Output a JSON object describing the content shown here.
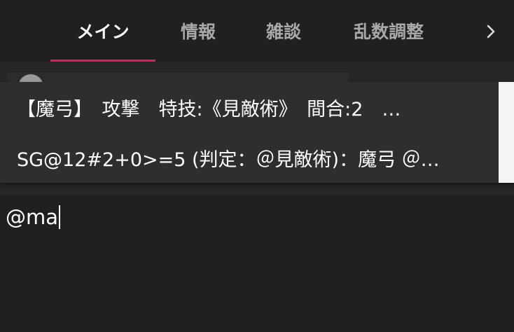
{
  "tabs": [
    {
      "label": "メイン",
      "active": true
    },
    {
      "label": "情報",
      "active": false
    },
    {
      "label": "雑談",
      "active": false
    },
    {
      "label": "乱数調整",
      "active": false
    }
  ],
  "scroll_icon": "chevron-right-icon",
  "autocomplete": {
    "items": [
      {
        "text": "【魔弓】　攻撃　特技:《見敵術》　間合:2　…"
      },
      {
        "text": "SG@12#2+0>=5 (判定：＠見敵術)：魔弓 ＠…"
      }
    ]
  },
  "chat_input": {
    "value": "@ma"
  },
  "colors": {
    "accent": "#e8175d",
    "background": "#202020",
    "popup": "#2e2e2e"
  }
}
